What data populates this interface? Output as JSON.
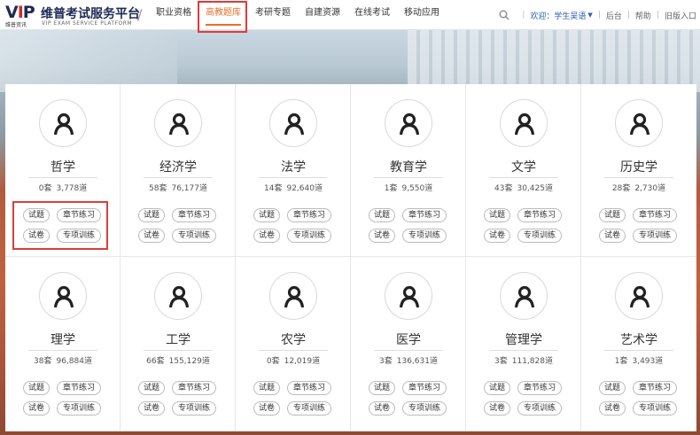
{
  "header": {
    "logo_vip": "VIP",
    "logo_sub": "维普资讯",
    "logo_title": "维普考试服务平台",
    "logo_en": "VIP EXAM SERVICE PLATFORM",
    "nav": [
      "职业资格",
      "高教题库",
      "考研专题",
      "自建资源",
      "在线考试",
      "移动应用"
    ],
    "active_nav": "高教题库",
    "welcome": "欢迎：学生吴语",
    "backend": "后台",
    "help": "帮助",
    "old_version": "旧版入口"
  },
  "buttons": {
    "questions": "试题",
    "chapter": "章节练习",
    "papers": "试卷",
    "special": "专项训练"
  },
  "subjects": [
    {
      "name": "哲学",
      "sets": "0套",
      "count": "3,778道"
    },
    {
      "name": "经济学",
      "sets": "58套",
      "count": "76,177道"
    },
    {
      "name": "法学",
      "sets": "14套",
      "count": "92,640道"
    },
    {
      "name": "教育学",
      "sets": "1套",
      "count": "9,550道"
    },
    {
      "name": "文学",
      "sets": "43套",
      "count": "30,425道"
    },
    {
      "name": "历史学",
      "sets": "28套",
      "count": "2,730道"
    },
    {
      "name": "理学",
      "sets": "38套",
      "count": "96,884道"
    },
    {
      "name": "工学",
      "sets": "66套",
      "count": "155,129道"
    },
    {
      "name": "农学",
      "sets": "0套",
      "count": "12,019道"
    },
    {
      "name": "医学",
      "sets": "3套",
      "count": "136,631道"
    },
    {
      "name": "管理学",
      "sets": "3套",
      "count": "111,828道"
    },
    {
      "name": "艺术学",
      "sets": "1套",
      "count": "3,493道"
    }
  ],
  "colors": {
    "accent": "#e8702a",
    "highlight": "#d8413a",
    "brand": "#1e2a55"
  }
}
